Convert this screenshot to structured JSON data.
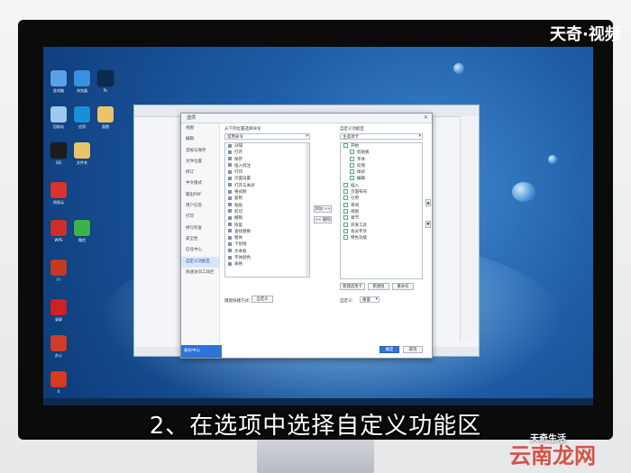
{
  "brand": "天奇·视频",
  "caption": "2、在选项中选择自定义功能区",
  "watermark_top": "天奇生活",
  "watermark_bottom": "云南龙网",
  "dialog": {
    "title": "选项",
    "nav_items": [
      "视图",
      "编辑",
      "常规与保存",
      "文件位置",
      "修订",
      "中文版式",
      "输出PDF",
      "用户信息",
      "打印",
      "拼写检查",
      "安全性",
      "信任中心",
      "自定义功能区",
      "快速访问工具栏"
    ],
    "active_nav_index": 12,
    "nav_footer": "备份中心",
    "left_header": "从下列位置选择命令",
    "left_select": "常用命令",
    "left_items": [
      "分隔",
      "打开",
      "保存",
      "插入批注",
      "打印",
      "页面设置",
      "打开与关闭",
      "格式刷",
      "复制",
      "粘贴",
      "剪切",
      "撤销",
      "恢复",
      "查找替换",
      "粗体",
      "下划线",
      "文本框",
      "字体颜色",
      "表格"
    ],
    "right_header": "自定义功能区",
    "right_select": "主选项卡",
    "right_items": [
      {
        "label": "开始",
        "level": 0
      },
      {
        "label": "剪贴板",
        "level": 1
      },
      {
        "label": "字体",
        "level": 1
      },
      {
        "label": "段落",
        "level": 1
      },
      {
        "label": "样式",
        "level": 1
      },
      {
        "label": "编辑",
        "level": 1
      },
      {
        "label": "插入",
        "level": 0
      },
      {
        "label": "页面布局",
        "level": 0
      },
      {
        "label": "引用",
        "level": 0
      },
      {
        "label": "审阅",
        "level": 0
      },
      {
        "label": "视图",
        "level": 0
      },
      {
        "label": "章节",
        "level": 0
      },
      {
        "label": "开发工具",
        "level": 0
      },
      {
        "label": "会员专享",
        "level": 0
      },
      {
        "label": "特色功能",
        "level": 0
      }
    ],
    "add_button": "添加 >>",
    "remove_button": "<< 删除",
    "new_tab_button": "新建选项卡",
    "new_group_button": "新建组",
    "rename_button": "重命名",
    "reset_label": "自定义:",
    "reset_button": "重置",
    "keyboard_label": "键盘快捷方式:",
    "keyboard_button": "自定义",
    "ok_button": "确定",
    "cancel_button": "取消"
  },
  "desktop_icons": [
    {
      "name": "此电脑",
      "color": "#5aa0e8"
    },
    {
      "name": "回收站",
      "color": "#9fc8ee"
    },
    {
      "name": "QQ",
      "color": "#1c1c1c"
    },
    {
      "name": "网易云",
      "color": "#d8332f"
    },
    {
      "name": "WPS",
      "color": "#c9302c"
    },
    {
      "name": "Fl",
      "color": "#c43a1f"
    },
    {
      "name": "录屏",
      "color": "#cc2222"
    },
    {
      "name": "办公",
      "color": "#d23a2a"
    },
    {
      "name": "浏览器",
      "color": "#3a8fe0"
    },
    {
      "name": "X",
      "color": "#d63a1f"
    },
    {
      "name": "应用",
      "color": "#1a8fd8"
    },
    {
      "name": "微信",
      "color": "#3bb34a"
    },
    {
      "name": "文件夹",
      "color": "#e9c46a"
    },
    {
      "name": "Ps",
      "color": "#0e2a4a"
    },
    {
      "name": "画图",
      "color": "#e9c46a"
    }
  ]
}
